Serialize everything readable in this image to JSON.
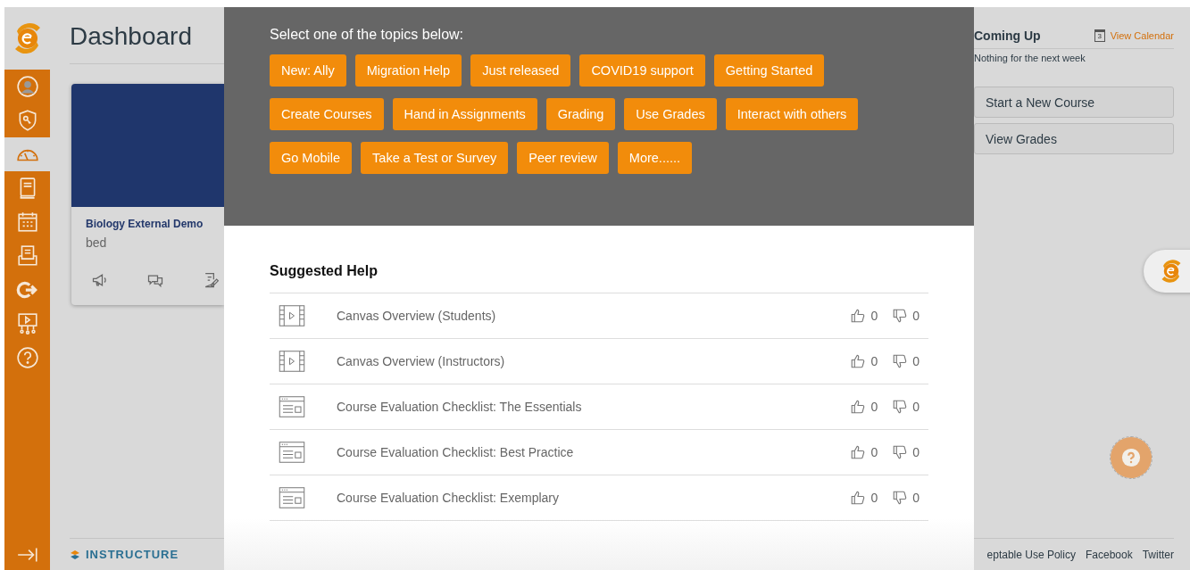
{
  "nav": {
    "items": [
      {
        "kind": "account",
        "selected": false
      },
      {
        "kind": "admin",
        "selected": false
      },
      {
        "kind": "dashboard",
        "selected": true
      },
      {
        "kind": "courses",
        "selected": false
      },
      {
        "kind": "calendar",
        "selected": false
      },
      {
        "kind": "inbox",
        "selected": false
      },
      {
        "kind": "logout",
        "selected": false
      },
      {
        "kind": "studio",
        "selected": false
      },
      {
        "kind": "help",
        "selected": false
      }
    ]
  },
  "page": {
    "title": "Dashboard",
    "course_card": {
      "title": "Biology External Demo",
      "subtitle": "bed",
      "color": "#1f366c"
    }
  },
  "sidebar": {
    "heading": "Coming Up",
    "calendar_link": "View Calendar",
    "calendar_day": "3",
    "empty_text": "Nothing for the next week",
    "buttons": [
      "Start a New Course",
      "View Grades"
    ]
  },
  "footer": {
    "brand": "INSTRUCTURE",
    "links": [
      "eptable Use Policy",
      "Facebook",
      "Twitter"
    ]
  },
  "modal": {
    "prompt": "Select one of the topics below:",
    "topics": [
      [
        "New: Ally",
        "Migration Help",
        "Just released",
        "COVID19 support",
        "Getting Started"
      ],
      [
        "Create Courses",
        "Hand in Assignments",
        "Grading",
        "Use Grades",
        "Interact with others"
      ],
      [
        "Go Mobile",
        "Take a Test or Survey",
        "Peer review",
        "More......"
      ]
    ],
    "help_heading": "Suggested Help",
    "help_items": [
      {
        "kind": "video",
        "title": "Canvas Overview (Students)",
        "likes": "0",
        "dislikes": "0"
      },
      {
        "kind": "video",
        "title": "Canvas Overview (Instructors)",
        "likes": "0",
        "dislikes": "0"
      },
      {
        "kind": "page",
        "title": "Course Evaluation Checklist: The Essentials",
        "likes": "0",
        "dislikes": "0"
      },
      {
        "kind": "page",
        "title": "Course Evaluation Checklist: Best Practice",
        "likes": "0",
        "dislikes": "0"
      },
      {
        "kind": "page",
        "title": "Course Evaluation Checklist: Exemplary",
        "likes": "0",
        "dislikes": "0"
      }
    ]
  }
}
